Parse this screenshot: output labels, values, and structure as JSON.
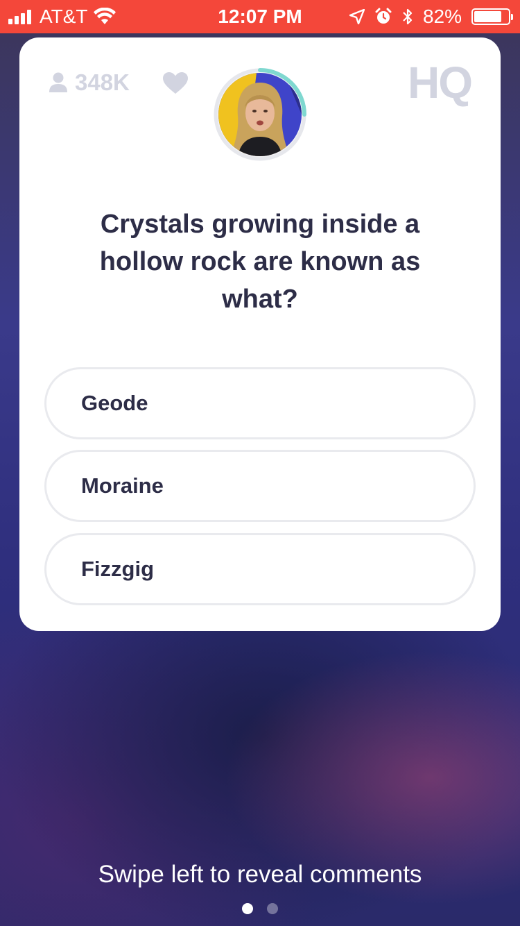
{
  "status_bar": {
    "carrier": "AT&T",
    "time": "12:07 PM",
    "battery_percent": "82%",
    "battery_level": 0.82,
    "icons": [
      "signal-icon",
      "wifi-icon",
      "location-arrow-icon",
      "alarm-icon",
      "bluetooth-icon",
      "battery-icon"
    ],
    "background_color": "#f4473a"
  },
  "game": {
    "viewer_count": "348K",
    "logo": "HQ",
    "timer_progress": 0.25,
    "question": "Crystals growing inside a hollow rock are known as what?",
    "answers": [
      {
        "label": "Geode"
      },
      {
        "label": "Moraine"
      },
      {
        "label": "Fizzgig"
      }
    ],
    "accent_color": "#7fd8d0",
    "text_color": "#2d2d47"
  },
  "footer": {
    "hint": "Swipe left to reveal comments",
    "page_count": 2,
    "active_page": 1
  }
}
